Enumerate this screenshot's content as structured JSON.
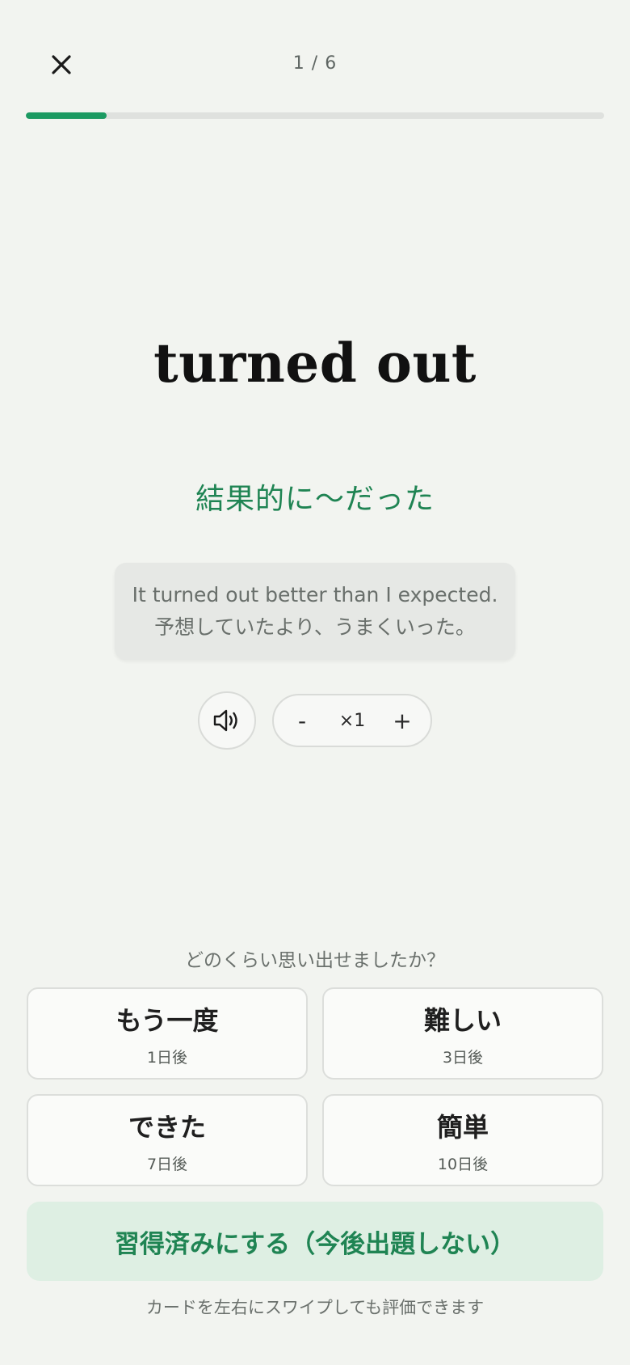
{
  "header": {
    "close_icon": "close-icon",
    "progress_text": "1 / 6",
    "progress_fraction": 0.14,
    "accent_color": "#1c9a62"
  },
  "card": {
    "term": "turned out",
    "meaning": "結果的に〜だった",
    "example_en": "It turned out better than I expected.",
    "example_ja": "予想していたより、うまくいった。"
  },
  "audio": {
    "speaker_icon": "speaker-icon",
    "speed_minus": "-",
    "speed_value": "×1",
    "speed_plus": "+"
  },
  "rating": {
    "question": "どのくらい思い出せましたか？",
    "buttons": [
      {
        "label": "もう一度",
        "interval": "1日後"
      },
      {
        "label": "難しい",
        "interval": "3日後"
      },
      {
        "label": "できた",
        "interval": "7日後"
      },
      {
        "label": "簡単",
        "interval": "10日後"
      }
    ]
  },
  "mastered": {
    "label": "習得済みにする（今後出題しない）"
  },
  "hint": {
    "text": "カードを左右にスワイプしても評価できます"
  }
}
